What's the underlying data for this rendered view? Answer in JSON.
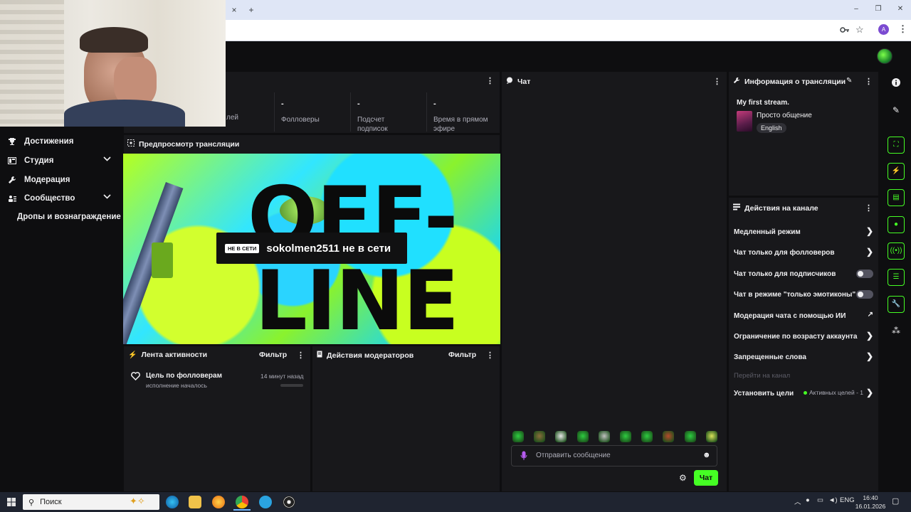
{
  "browser": {
    "close_tab": "×",
    "new_tab": "+",
    "window_minimize": "–",
    "window_restore": "❐",
    "window_close": "✕",
    "profile_initial": "A"
  },
  "leftnav": {
    "items": [
      {
        "label": "Достижения",
        "icon": "trophy-icon",
        "has_chevron": false
      },
      {
        "label": "Студия",
        "icon": "studio-icon",
        "has_chevron": true
      },
      {
        "label": "Модерация",
        "icon": "wrench-icon",
        "has_chevron": false
      },
      {
        "label": "Сообщество",
        "icon": "community-icon",
        "has_chevron": true
      }
    ],
    "drops_label": "Дропы и вознаграждение",
    "chevron": "⌄"
  },
  "stats": {
    "partial_label": "лей",
    "columns": [
      {
        "value": "-",
        "label": "Фолловеры"
      },
      {
        "value": "-",
        "label": "Подсчет подписок"
      },
      {
        "value": "-",
        "label": "Время в прямом эфире"
      }
    ]
  },
  "preview": {
    "title": "Предпросмотр трансляции",
    "offline_badge": "НЕ В СЕТИ",
    "offline_message": "sokolmen2511 не в сети",
    "art_top": "OFF-",
    "art_bottom": "LINE"
  },
  "activity": {
    "title": "Лента активности",
    "filter": "Фильтр",
    "item_title": "Цель по фолловерам",
    "item_sub": "исполнение началось",
    "item_time": "14 минут назад"
  },
  "modactions": {
    "title": "Действия модераторов",
    "filter": "Фильтр"
  },
  "chat": {
    "title": "Чат",
    "placeholder": "Отправить сообщение",
    "send_label": "Чат",
    "emote_colors": [
      "#2ecc40",
      "#8a6d3b",
      "#e8e8e8",
      "#2ecc40",
      "#c0c0c0",
      "#2ecc40",
      "#2ecc40",
      "#b44a2b",
      "#2ecc40",
      "#d9e25a"
    ]
  },
  "streaminfo": {
    "title": "Информация о трансляции",
    "stream_title": "My first stream.",
    "category": "Просто общение",
    "language": "English"
  },
  "channel_actions": {
    "title": "Действия на канале",
    "rows": [
      {
        "label": "Медленный режим",
        "control": "arrow"
      },
      {
        "label": "Чат только для фолловеров",
        "control": "arrow"
      },
      {
        "label": "Чат только для подписчиков",
        "control": "toggle"
      },
      {
        "label": "Чат в режиме \"только эмотиконы\"",
        "control": "toggle"
      },
      {
        "label": "Модерация чата с помощью ИИ",
        "control": "external"
      },
      {
        "label": "Ограничение по возрасту аккаунта",
        "control": "arrow"
      },
      {
        "label": "Запрещенные слова",
        "control": "arrow"
      }
    ],
    "goto_channel": "Перейти на канал",
    "goals_label": "Установить цели",
    "goals_status": "Активных целей - 1"
  },
  "taskbar": {
    "search_placeholder": "Поиск",
    "lang": "ENG",
    "time": "16:40",
    "date": "16.01.2026"
  },
  "colors": {
    "accent": "#45fe24",
    "panel": "#18181b",
    "background": "#0e0e10"
  }
}
